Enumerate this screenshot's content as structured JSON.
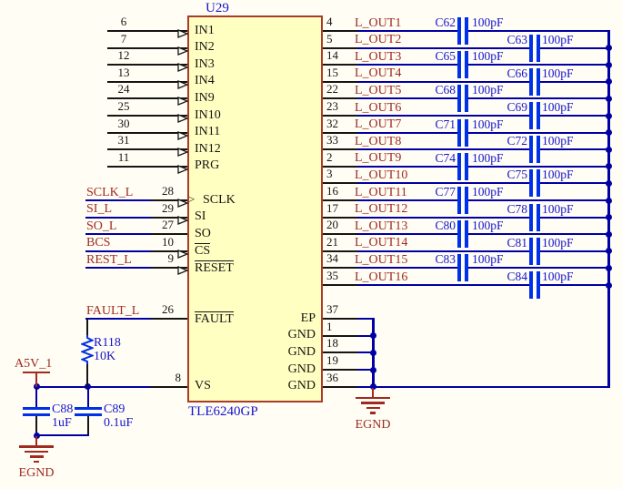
{
  "schematic": {
    "ic": {
      "designator": "U29",
      "part": "TLE6240GP"
    },
    "left_pins": [
      {
        "row": 1,
        "num": "6",
        "name": "IN1",
        "arrow": true,
        "overline": false
      },
      {
        "row": 2,
        "num": "7",
        "name": "IN2",
        "arrow": true,
        "overline": false
      },
      {
        "row": 3,
        "num": "12",
        "name": "IN3",
        "arrow": true,
        "overline": false
      },
      {
        "row": 4,
        "num": "13",
        "name": "IN4",
        "arrow": true,
        "overline": false
      },
      {
        "row": 5,
        "num": "24",
        "name": "IN9",
        "arrow": true,
        "overline": false
      },
      {
        "row": 6,
        "num": "25",
        "name": "IN10",
        "arrow": true,
        "overline": false
      },
      {
        "row": 7,
        "num": "30",
        "name": "IN11",
        "arrow": true,
        "overline": false
      },
      {
        "row": 8,
        "num": "31",
        "name": "IN12",
        "arrow": true,
        "overline": false
      },
      {
        "row": 9,
        "num": "11",
        "name": "PRG",
        "arrow": true,
        "overline": false
      },
      {
        "row": 11,
        "num": "28",
        "name": "SCLK",
        "arrow": true,
        "overline": false,
        "net": "SCLK_L",
        "clock": true
      },
      {
        "row": 12,
        "num": "29",
        "name": "SI",
        "arrow": true,
        "overline": false,
        "net": "SI_L"
      },
      {
        "row": 13,
        "num": "27",
        "name": "SO",
        "arrow": false,
        "overline": false,
        "net": "SO_L"
      },
      {
        "row": 14,
        "num": "10",
        "name": "CS",
        "arrow": true,
        "overline": true,
        "net": "BCS"
      },
      {
        "row": 15,
        "num": "9",
        "name": "RESET",
        "arrow": true,
        "overline": true,
        "net": "REST_L"
      },
      {
        "row": 18,
        "num": "26",
        "name": "FAULT",
        "arrow": false,
        "overline": true,
        "net": "FAULT_L"
      },
      {
        "row": 22,
        "num": "8",
        "name": "VS",
        "arrow": false,
        "overline": false,
        "rail": true
      }
    ],
    "right_pins": [
      {
        "row": 1,
        "num": "4",
        "name": "OUT1",
        "net": "L_OUT1",
        "cap": {
          "ref": "C62",
          "value": "100pF",
          "col": "odd"
        }
      },
      {
        "row": 2,
        "num": "5",
        "name": "OUT2",
        "net": "L_OUT2",
        "cap": {
          "ref": "C63",
          "value": "100pF",
          "col": "even"
        }
      },
      {
        "row": 3,
        "num": "14",
        "name": "OUT3",
        "net": "L_OUT3",
        "cap": {
          "ref": "C65",
          "value": "100pF",
          "col": "odd"
        }
      },
      {
        "row": 4,
        "num": "15",
        "name": "OUT4",
        "net": "L_OUT4",
        "cap": {
          "ref": "C66",
          "value": "100pF",
          "col": "even"
        }
      },
      {
        "row": 5,
        "num": "22",
        "name": "OUT5",
        "net": "L_OUT5",
        "cap": {
          "ref": "C68",
          "value": "100pF",
          "col": "odd"
        }
      },
      {
        "row": 6,
        "num": "23",
        "name": "OUT6",
        "net": "L_OUT6",
        "cap": {
          "ref": "C69",
          "value": "100pF",
          "col": "even"
        }
      },
      {
        "row": 7,
        "num": "32",
        "name": "OUT7",
        "net": "L_OUT7",
        "cap": {
          "ref": "C71",
          "value": "100pF",
          "col": "odd"
        }
      },
      {
        "row": 8,
        "num": "33",
        "name": "OUT8",
        "net": "L_OUT8",
        "cap": {
          "ref": "C72",
          "value": "100pF",
          "col": "even"
        }
      },
      {
        "row": 9,
        "num": "2",
        "name": "OUT9",
        "net": "L_OUT9",
        "cap": {
          "ref": "C74",
          "value": "100pF",
          "col": "odd"
        }
      },
      {
        "row": 10,
        "num": "3",
        "name": "OUT10",
        "net": "L_OUT10",
        "cap": {
          "ref": "C75",
          "value": "100pF",
          "col": "even"
        }
      },
      {
        "row": 11,
        "num": "16",
        "name": "OUT11",
        "net": "L_OUT11",
        "cap": {
          "ref": "C77",
          "value": "100pF",
          "col": "odd"
        }
      },
      {
        "row": 12,
        "num": "17",
        "name": "OUT12",
        "net": "L_OUT12",
        "cap": {
          "ref": "C78",
          "value": "100pF",
          "col": "even"
        }
      },
      {
        "row": 13,
        "num": "20",
        "name": "OUT13",
        "net": "L_OUT13",
        "cap": {
          "ref": "C80",
          "value": "100pF",
          "col": "odd"
        }
      },
      {
        "row": 14,
        "num": "21",
        "name": "OUT14",
        "net": "L_OUT14",
        "cap": {
          "ref": "C81",
          "value": "100pF",
          "col": "even"
        }
      },
      {
        "row": 15,
        "num": "34",
        "name": "OUT15",
        "net": "L_OUT15",
        "cap": {
          "ref": "C83",
          "value": "100pF",
          "col": "odd"
        }
      },
      {
        "row": 16,
        "num": "35",
        "name": "OUT16",
        "net": "L_OUT16",
        "cap": {
          "ref": "C84",
          "value": "100pF",
          "col": "even"
        }
      }
    ],
    "gnd_pins": [
      {
        "row": 18,
        "num": "37",
        "name": "EP"
      },
      {
        "row": 19,
        "num": "1",
        "name": "GND"
      },
      {
        "row": 20,
        "num": "18",
        "name": "GND"
      },
      {
        "row": 21,
        "num": "19",
        "name": "GND"
      },
      {
        "row": 22,
        "num": "36",
        "name": "GND"
      }
    ],
    "pullup_resistor": {
      "ref": "R118",
      "value": "10K"
    },
    "decoupling_caps": [
      {
        "ref": "C88",
        "value": "1uF"
      },
      {
        "ref": "C89",
        "value": "0.1uF"
      }
    ],
    "power_rail": {
      "name": "A5V_1"
    },
    "ground_left": "EGND",
    "ground_right": "EGND",
    "clock_arrow_glyph": ">",
    "colors": {
      "background": "#FFFDF4",
      "ic_fill": "#FFFFC2",
      "ic_border": "#AA3A2A",
      "wire": "#0000A5",
      "pin": "#151515",
      "plate": "#0030E8",
      "net_label": "#9E2A20",
      "power": "#9E2A20",
      "designator_text": "#1414CC"
    }
  }
}
